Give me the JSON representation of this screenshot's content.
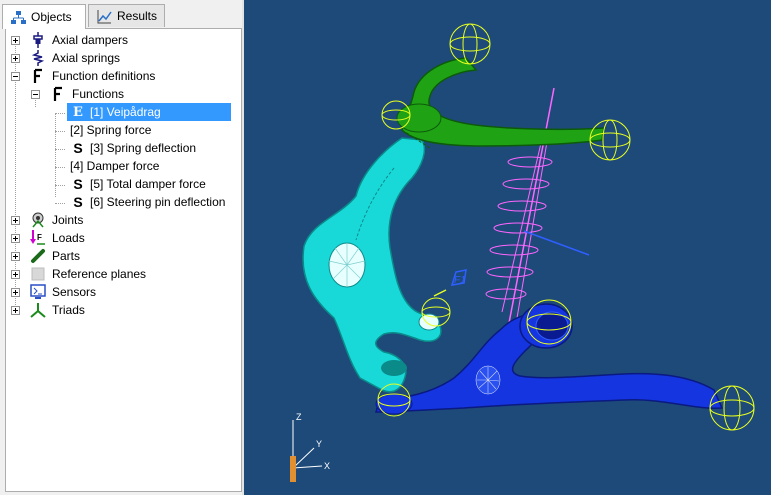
{
  "tabs": [
    {
      "label": "Objects",
      "icon": "hierarchy-icon",
      "active": true
    },
    {
      "label": "Results",
      "icon": "chart-icon",
      "active": false
    }
  ],
  "tree": [
    {
      "label": "Axial dampers",
      "icon": "damper-icon",
      "expander": "plus"
    },
    {
      "label": "Axial springs",
      "icon": "spring-icon",
      "expander": "plus"
    },
    {
      "label": "Function definitions",
      "icon": "function-icon",
      "expander": "minus"
    },
    {
      "label": "Functions",
      "icon": "function-icon",
      "expander": "minus"
    },
    {
      "label": "[1] Veipådrag",
      "icon": "E-icon",
      "selected": true
    },
    {
      "label": "[2] Spring force",
      "icon": ""
    },
    {
      "label": "[3] Spring deflection",
      "icon": "S-icon"
    },
    {
      "label": "[4] Damper force",
      "icon": ""
    },
    {
      "label": "[5] Total damper force",
      "icon": "S-icon"
    },
    {
      "label": "[6] Steering pin deflection",
      "icon": "S-icon"
    },
    {
      "label": "Joints",
      "icon": "joint-icon",
      "expander": "plus"
    },
    {
      "label": "Loads",
      "icon": "load-icon",
      "expander": "plus"
    },
    {
      "label": "Parts",
      "icon": "part-icon",
      "expander": "plus"
    },
    {
      "label": "Reference planes",
      "icon": "plane-icon",
      "expander": "plus"
    },
    {
      "label": "Sensors",
      "icon": "sensor-icon",
      "expander": "plus"
    },
    {
      "label": "Triads",
      "icon": "triad-icon",
      "expander": "plus"
    }
  ],
  "viewport": {
    "background": "#1d4a79",
    "axis_labels": {
      "z": "Z",
      "y": "Y",
      "x": "X"
    },
    "load_label": "F1",
    "colors": {
      "upper_arm": "#1fa315",
      "knuckle": "#18d8d8",
      "lower_arm": "#1535e0",
      "spring": "#ff66ff",
      "triad": "#e8ff20"
    }
  }
}
